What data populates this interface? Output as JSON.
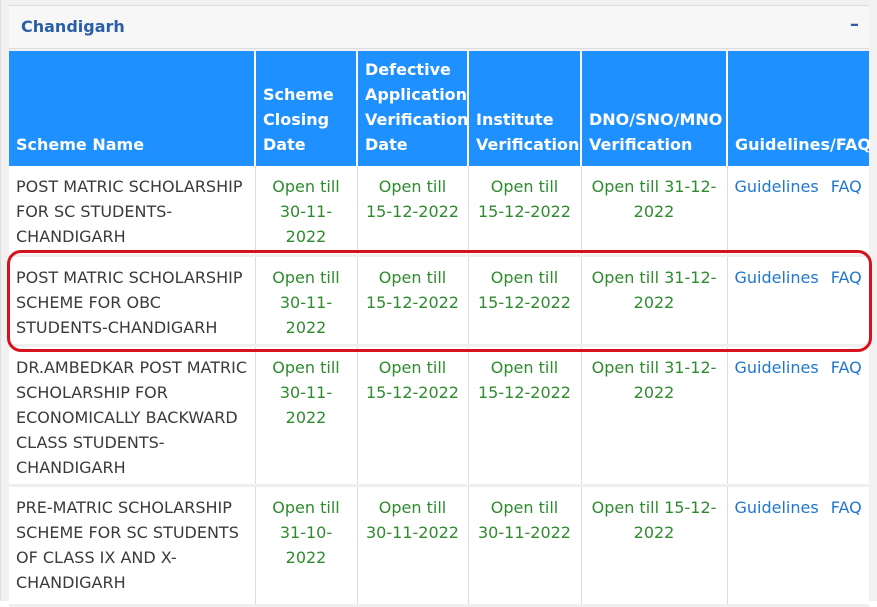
{
  "panel": {
    "title": "Chandigarh",
    "collapse_symbol": "–",
    "accent_color": "#2a5fa8"
  },
  "table": {
    "header_bg": "#1e90ff",
    "headers": {
      "scheme_name": "Scheme Name",
      "closing_date": "Scheme Closing Date",
      "defective": "Defective Application Verification Date",
      "institute": "Institute Verification",
      "dno": "DNO/SNO/MNO Verification",
      "guidelines_faq": "Guidelines/FAQ"
    },
    "rows": [
      {
        "scheme": "POST MATRIC SCHOLARSHIP FOR SC STUDENTS-CHANDIGARH",
        "closing": "Open till 30-11-2022",
        "defective": "Open till 15-12-2022",
        "institute": "Open till 15-12-2022",
        "dno": "Open till 31-12-2022",
        "guidelines": "Guidelines",
        "faq": "FAQ"
      },
      {
        "scheme": "POST MATRIC SCHOLARSHIP SCHEME FOR OBC STUDENTS-CHANDIGARH",
        "closing": "Open till 30-11-2022",
        "defective": "Open till 15-12-2022",
        "institute": "Open till 15-12-2022",
        "dno": "Open till 31-12-2022",
        "guidelines": "Guidelines",
        "faq": "FAQ"
      },
      {
        "scheme": "DR.AMBEDKAR POST MATRIC SCHOLARSHIP FOR ECONOMICALLY BACKWARD CLASS STUDENTS-CHANDIGARH",
        "closing": "Open till 30-11-2022",
        "defective": "Open till 15-12-2022",
        "institute": "Open till 15-12-2022",
        "dno": "Open till 31-12-2022",
        "guidelines": "Guidelines",
        "faq": "FAQ"
      },
      {
        "scheme": "PRE-MATRIC SCHOLARSHIP SCHEME FOR SC STUDENTS OF CLASS IX AND X-CHANDIGARH",
        "closing": "Open till 31-10-2022",
        "defective": "Open till 30-11-2022",
        "institute": "Open till 30-11-2022",
        "dno": "Open till 15-12-2022",
        "guidelines": "Guidelines",
        "faq": "FAQ"
      }
    ]
  },
  "highlight_color": "#d7121f"
}
